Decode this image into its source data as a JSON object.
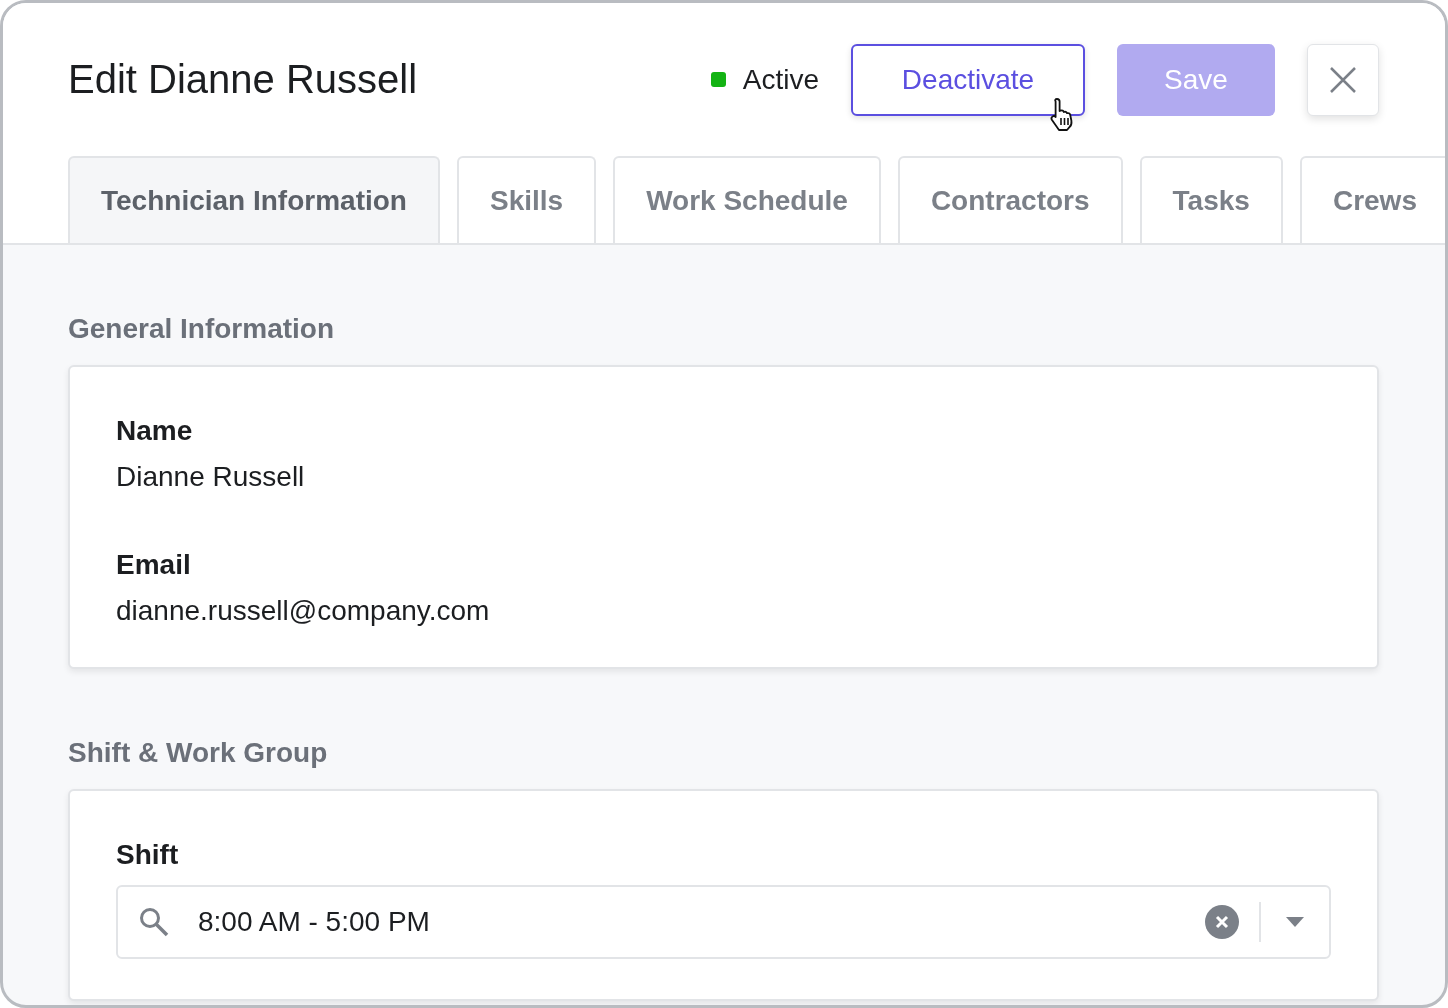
{
  "header": {
    "title": "Edit Dianne Russell",
    "status": {
      "label": "Active",
      "color": "#13b313"
    },
    "buttons": [
      {
        "label": "Deactivate",
        "kind": "outline",
        "disabled": false
      },
      {
        "label": "Save",
        "kind": "primary",
        "disabled": true
      }
    ]
  },
  "tabs": [
    {
      "label": "Technician Information",
      "selected": true
    },
    {
      "label": "Skills",
      "selected": false
    },
    {
      "label": "Work Schedule",
      "selected": false
    },
    {
      "label": "Contractors",
      "selected": false
    },
    {
      "label": "Tasks",
      "selected": false
    },
    {
      "label": "Crews",
      "selected": false
    }
  ],
  "sections": [
    {
      "title": "General Information",
      "fields": [
        {
          "kind": "text",
          "label": "Name",
          "value": "Dianne Russell"
        },
        {
          "kind": "text",
          "label": "Email",
          "value": "dianne.russell@company.com"
        }
      ]
    },
    {
      "title": "Shift & Work Group",
      "fields": [
        {
          "kind": "select",
          "label": "Shift",
          "value": "8:00 AM - 5:00 PM"
        }
      ]
    }
  ]
}
